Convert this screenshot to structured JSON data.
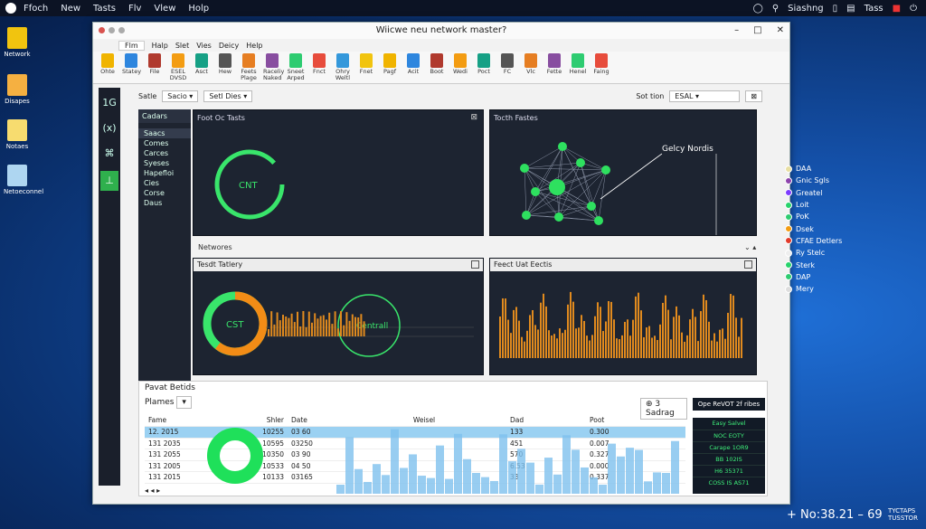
{
  "topbar": {
    "items": [
      "Ffoch",
      "New",
      "Tasts",
      "Flv",
      "Vlew",
      "Holp"
    ],
    "right": [
      "Siashng",
      "Tass"
    ]
  },
  "desktop": {
    "icons": [
      "Network",
      "Disapes",
      "Notaes",
      "Netoeconnel"
    ]
  },
  "window": {
    "title": "Wiicwe neu network master?",
    "controls": [
      "–",
      "□",
      "✕"
    ]
  },
  "menubar": [
    "Flm",
    "Halp",
    "Slet",
    "Vies",
    "Deicy",
    "Help"
  ],
  "ribbon": [
    "Ohte",
    "Statey",
    "File",
    "ESEL DVSD",
    "Asct",
    "Hew",
    "Feets Plage",
    "Raceliy Naked",
    "Sneet Arped",
    "Fnct",
    "Ohry Weltl",
    "Fnet",
    "Pagf",
    "Acit",
    "Boot",
    "Wedi",
    "Poct",
    "FC",
    "Vlc",
    "Fette",
    "Henel",
    "Faing"
  ],
  "nav": {
    "top": "1G",
    "second": "(x)"
  },
  "subtool": {
    "label": "Satle",
    "dd1": "Sacio",
    "dd2": "Setl Dies",
    "rlabel": "Sot tion",
    "rfield": "ESAL"
  },
  "sidebar": {
    "head": "Cadars",
    "items": [
      "Saacs",
      "Comes",
      "Carces",
      "Syeses",
      "Hapefloi",
      "Cies",
      "Corse",
      "Daus"
    ]
  },
  "panels": {
    "p1": {
      "title": "Foot Oc Tasts",
      "center": "CNT"
    },
    "p2": {
      "title": "Tocth Fastes",
      "annotation": "Gelcy Nordis"
    },
    "sec": "Networes",
    "p3": {
      "title": "Tesdt Tatlery",
      "gauge1": "CST",
      "gauge2": "Centrall"
    },
    "p4": {
      "title": "Feect Uat Eectis"
    }
  },
  "bottom": {
    "title": "Pavat Betids",
    "filter": "Plames",
    "search": "3 Sadrag",
    "headers": [
      "Fame",
      "Shler",
      "Date",
      "Weisel",
      "Dad",
      "Poot"
    ],
    "rows": [
      [
        "12. 2015",
        "10255",
        "03 60",
        "",
        "133",
        "0.300"
      ],
      [
        "131 2035",
        "10595",
        "03250",
        "",
        "451",
        "0.007"
      ],
      [
        "131 2055",
        "10350",
        "03 90",
        "",
        "570",
        "0.327"
      ],
      [
        "131 2005",
        "10533",
        "04 50",
        "",
        "6.53",
        "0.000"
      ],
      [
        "131 2015",
        "10133",
        "03165",
        "",
        "33",
        "0.337"
      ]
    ],
    "tile_head": "Ope ReVOT 2f ribes",
    "tile_items": [
      "Easy Salvel",
      "NOC EOTY",
      "Carape 1OR9",
      "BB 102IS",
      "H6 35371",
      "COSS IS AS71"
    ]
  },
  "legend": [
    {
      "label": "DAA",
      "color": "#e8dfa3"
    },
    {
      "label": "Gnic Sgls",
      "color": "#8e44ad"
    },
    {
      "label": "Greatel",
      "color": "#7d3cff"
    },
    {
      "label": "Loit",
      "color": "#27d36b"
    },
    {
      "label": "PoK",
      "color": "#2ecc71"
    },
    {
      "label": "Dsek",
      "color": "#f39c12"
    },
    {
      "label": "CFAE Detlers",
      "color": "#e23a2a"
    },
    {
      "label": "Ry Stelc",
      "color": "#eeeeee"
    },
    {
      "label": "Sterk",
      "color": "#27d36b"
    },
    {
      "label": "DAP",
      "color": "#2ecc71"
    },
    {
      "label": "Mery",
      "color": "#dddddd"
    }
  ],
  "clock": {
    "time": "+ No:38.21 – 69",
    "tag1": "TYCTAPS",
    "tag2": "TUSSTOR"
  }
}
